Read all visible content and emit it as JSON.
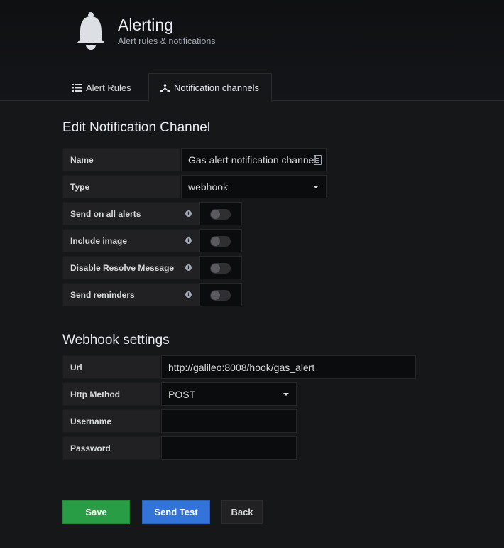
{
  "header": {
    "title": "Alerting",
    "subtitle": "Alert rules & notifications",
    "icon": "bell-icon"
  },
  "tabs": [
    {
      "label": "Alert Rules",
      "icon": "list-icon",
      "active": false
    },
    {
      "label": "Notification channels",
      "icon": "sitemap-icon",
      "active": true
    }
  ],
  "form": {
    "title": "Edit Notification Channel",
    "name_label": "Name",
    "name_value": "Gas alert notification channel",
    "type_label": "Type",
    "type_value": "webhook",
    "toggles": [
      {
        "label": "Send on all alerts",
        "on": false
      },
      {
        "label": "Include image",
        "on": false
      },
      {
        "label": "Disable Resolve Message",
        "on": false
      },
      {
        "label": "Send reminders",
        "on": false
      }
    ]
  },
  "webhook": {
    "title": "Webhook settings",
    "url_label": "Url",
    "url_value": "http://galileo:8008/hook/gas_alert",
    "method_label": "Http Method",
    "method_value": "POST",
    "username_label": "Username",
    "username_value": "",
    "password_label": "Password",
    "password_value": ""
  },
  "buttons": {
    "save": "Save",
    "send_test": "Send Test",
    "back": "Back"
  },
  "colors": {
    "background": "#161719",
    "save": "#299c46",
    "send_test": "#3274d9"
  }
}
